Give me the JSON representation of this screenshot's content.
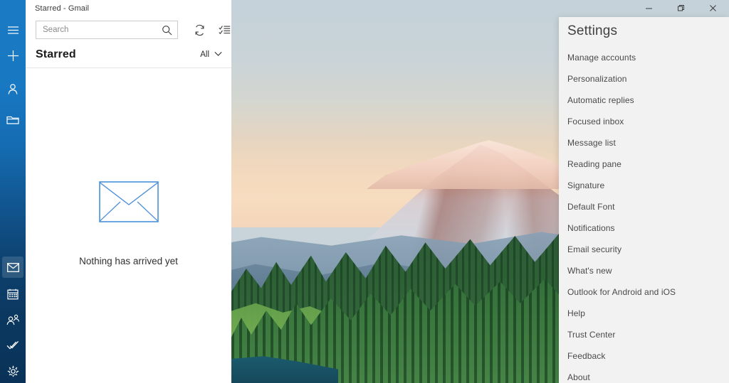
{
  "window": {
    "title": "Starred - Gmail",
    "controls": [
      {
        "name": "minimize-button",
        "glyph": "minimize"
      },
      {
        "name": "maximize-button",
        "glyph": "restore"
      },
      {
        "name": "close-button",
        "glyph": "close"
      }
    ]
  },
  "rail": {
    "top_items": [
      {
        "name": "hamburger-menu-icon",
        "label": "Navigation menu"
      },
      {
        "name": "new-mail-icon",
        "label": "New mail"
      },
      {
        "name": "account-icon",
        "label": "Accounts"
      },
      {
        "name": "folder-icon",
        "label": "Folders"
      }
    ],
    "bottom_items": [
      {
        "name": "mail-icon",
        "label": "Mail",
        "selected": true
      },
      {
        "name": "calendar-icon",
        "label": "Calendar",
        "selected": false
      },
      {
        "name": "people-icon",
        "label": "People",
        "selected": false
      },
      {
        "name": "tasks-icon",
        "label": "To Do",
        "selected": false
      },
      {
        "name": "settings-gear-icon",
        "label": "Settings",
        "selected": false
      }
    ]
  },
  "search": {
    "value": "",
    "placeholder": "Search"
  },
  "toolbar": {
    "sync_label": "Sync this view",
    "select_label": "Enter selection mode"
  },
  "list": {
    "title": "Starred",
    "filter_label": "All",
    "empty_message": "Nothing has arrived yet"
  },
  "settings": {
    "title": "Settings",
    "items": [
      {
        "label": "Manage accounts"
      },
      {
        "label": "Personalization"
      },
      {
        "label": "Automatic replies"
      },
      {
        "label": "Focused inbox"
      },
      {
        "label": "Message list"
      },
      {
        "label": "Reading pane"
      },
      {
        "label": "Signature"
      },
      {
        "label": "Default Font"
      },
      {
        "label": "Notifications"
      },
      {
        "label": "Email security"
      },
      {
        "label": "What's new"
      },
      {
        "label": "Outlook for Android and iOS"
      },
      {
        "label": "Help"
      },
      {
        "label": "Trust Center"
      },
      {
        "label": "Feedback"
      },
      {
        "label": "About"
      }
    ]
  },
  "colors": {
    "accent_blue": "#1b7ac4",
    "rail_bottom": "#0a3258",
    "settings_bg": "#f2f2f2",
    "envelope_outline": "#4a90d9"
  }
}
